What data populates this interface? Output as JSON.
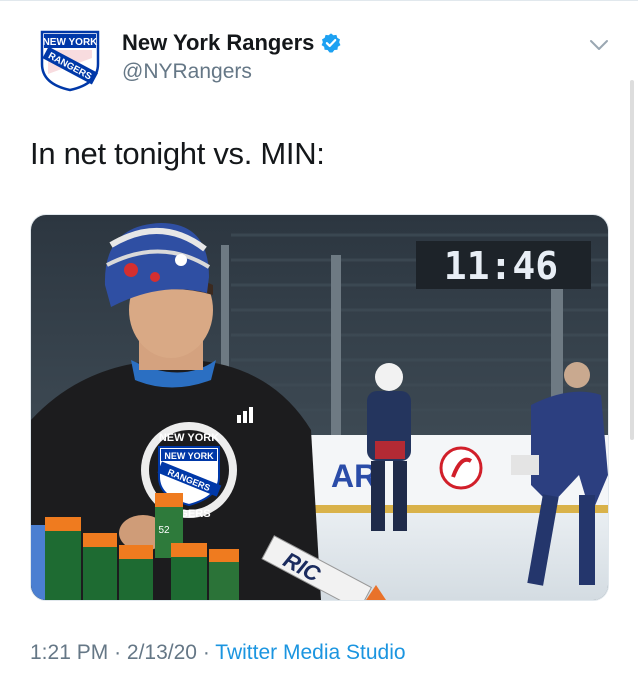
{
  "tweet": {
    "display_name": "New York Rangers",
    "handle": "@NYRangers",
    "text": "In net tonight vs. MIN:",
    "time": "1:21 PM",
    "date": "2/13/20",
    "separator": "·",
    "source": "Twitter Media Studio"
  },
  "avatar_logo": {
    "line1": "NEW YORK",
    "line2": "RANGERS"
  },
  "media": {
    "scoreboard_clock": "11:46",
    "jersey_crest_top": "NEW YORK",
    "jersey_crest_middle1": "NEW YORK",
    "jersey_crest_middle2": "RANGERS",
    "jersey_crest_bottom": "NGERS",
    "stick_text": "RIC",
    "bottle_number": "52"
  },
  "colors": {
    "link": "#1b95e0",
    "secondary_text": "#657786",
    "verified": "#1da1f2",
    "rangers_blue": "#0038a8",
    "rangers_red": "#ce1126"
  },
  "icons": {
    "verified": "verified-badge-icon",
    "more": "chevron-down-icon"
  }
}
